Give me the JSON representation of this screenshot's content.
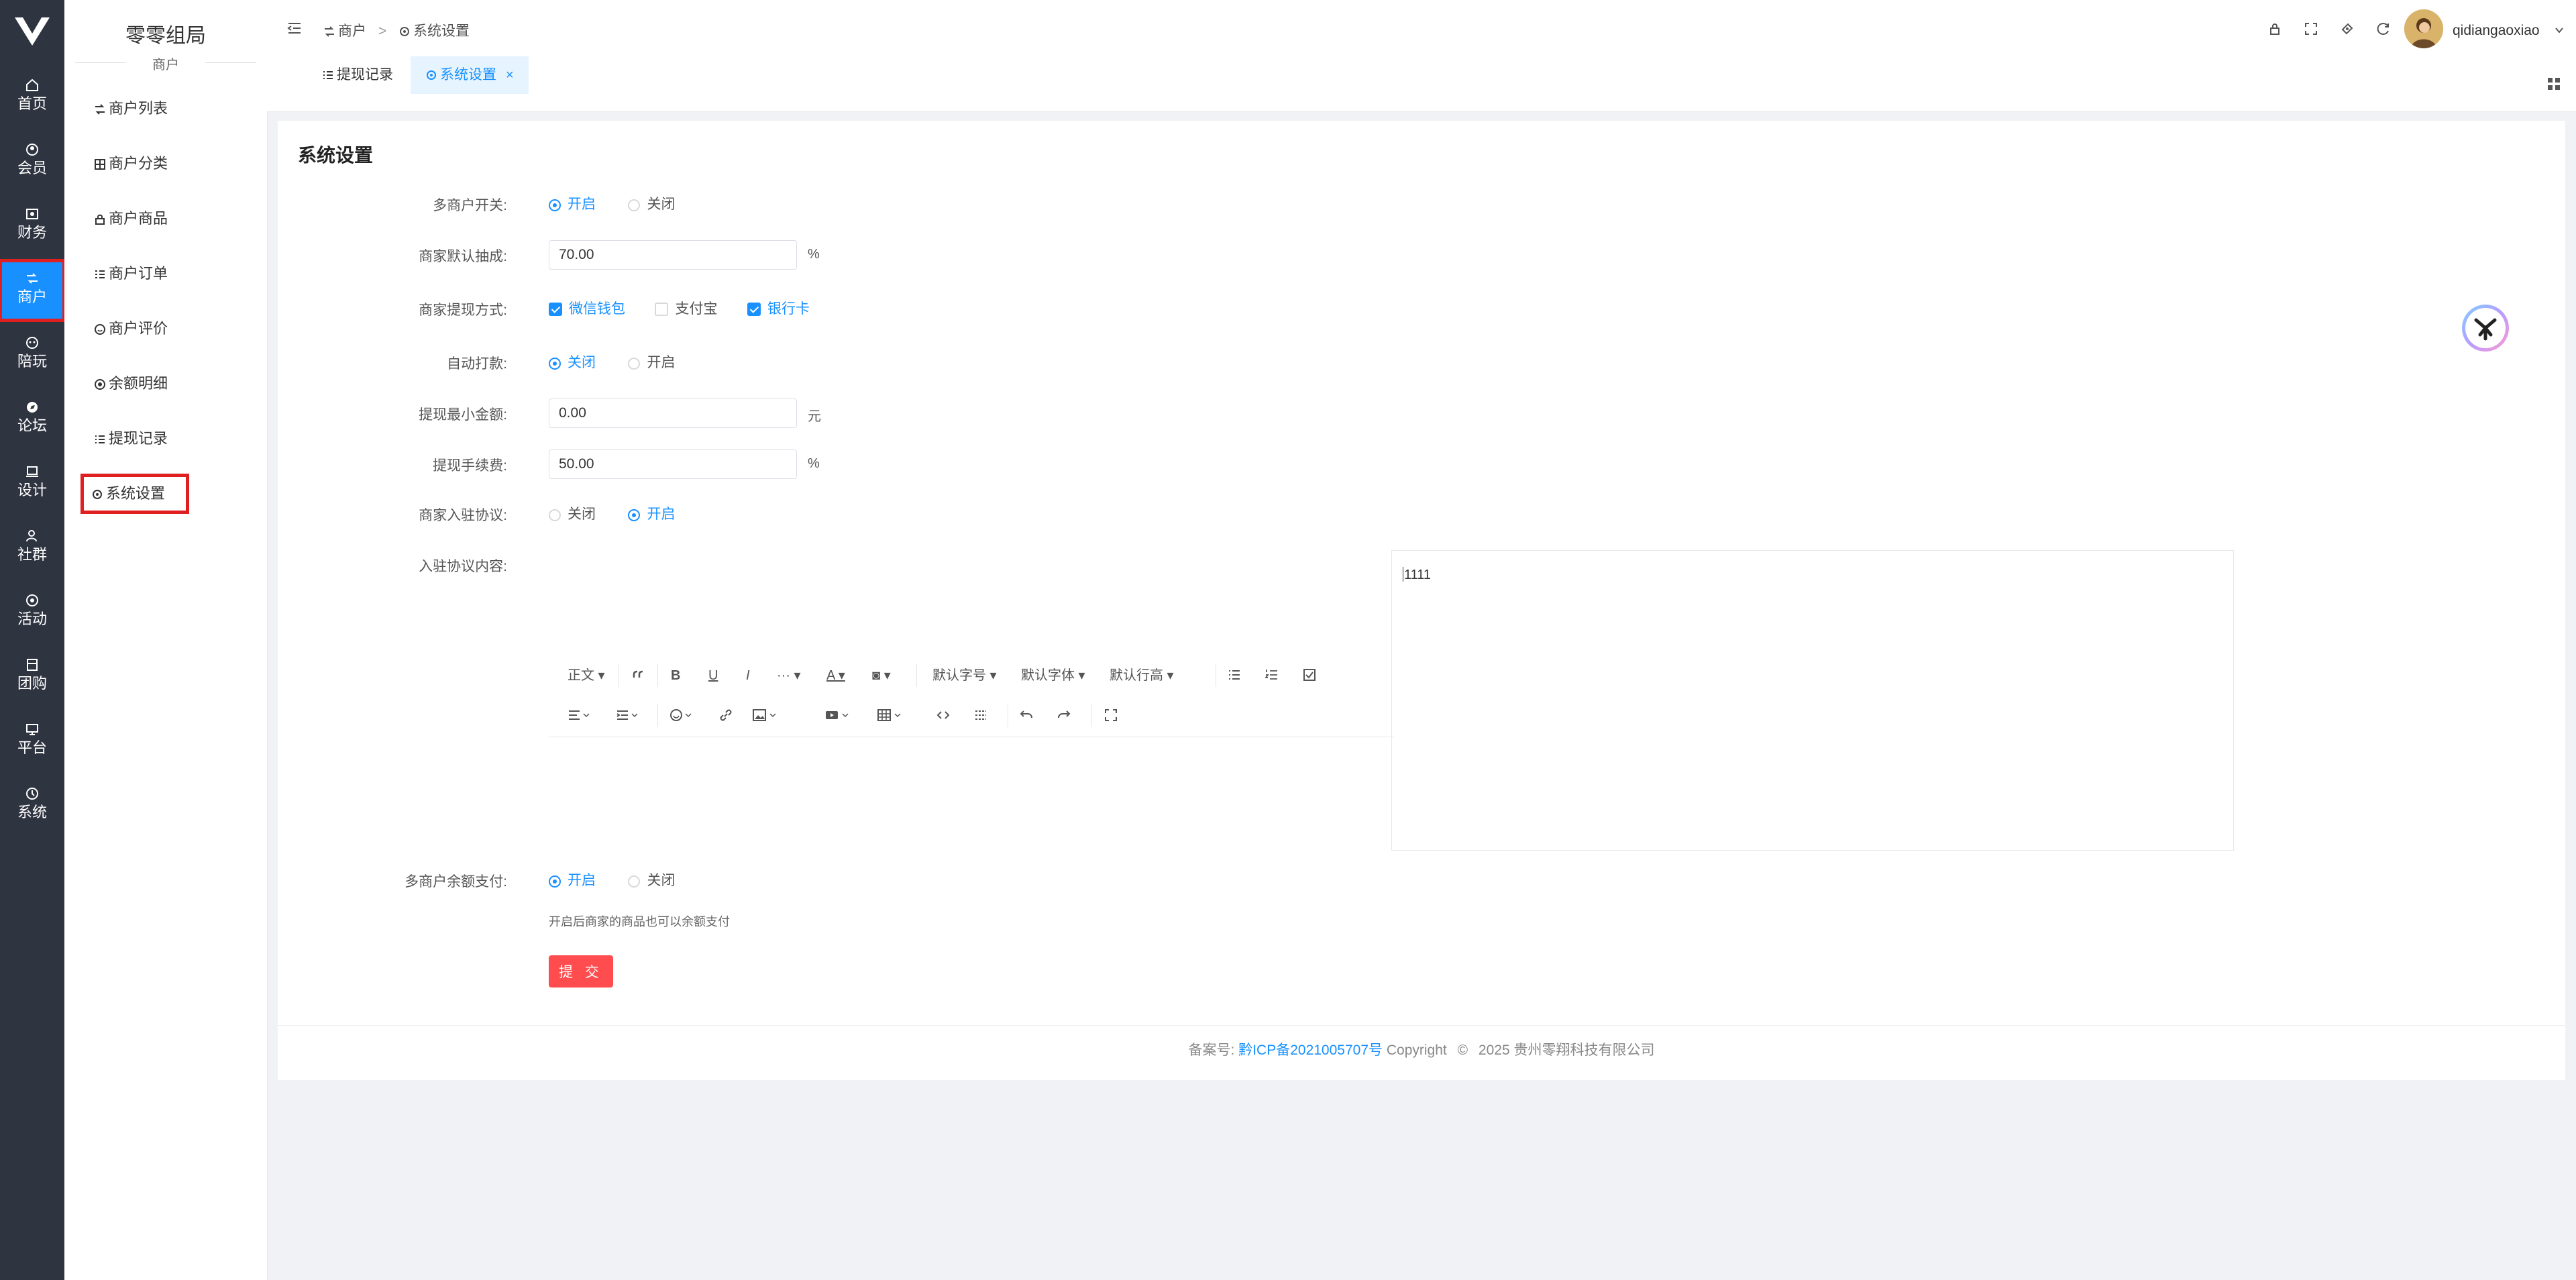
{
  "rail": {
    "items": [
      {
        "label": "首页",
        "icon": "home-icon"
      },
      {
        "label": "会员",
        "icon": "member-icon"
      },
      {
        "label": "财务",
        "icon": "finance-icon"
      },
      {
        "label": "商户",
        "icon": "merchant-icon",
        "active": true
      },
      {
        "label": "陪玩",
        "icon": "companion-icon"
      },
      {
        "label": "论坛",
        "icon": "forum-icon"
      },
      {
        "label": "设计",
        "icon": "design-icon"
      },
      {
        "label": "社群",
        "icon": "community-icon"
      },
      {
        "label": "活动",
        "icon": "activity-icon"
      },
      {
        "label": "团购",
        "icon": "group-buy-icon"
      },
      {
        "label": "平台",
        "icon": "platform-icon"
      },
      {
        "label": "系统",
        "icon": "system-icon"
      }
    ]
  },
  "subnav": {
    "org_name": "零零组局",
    "section": "商户",
    "items": [
      {
        "label": "商户列表",
        "icon": "merchant-list-icon"
      },
      {
        "label": "商户分类",
        "icon": "category-grid-icon"
      },
      {
        "label": "商户商品",
        "icon": "product-lock-icon"
      },
      {
        "label": "商户订单",
        "icon": "order-list-icon"
      },
      {
        "label": "商户评价",
        "icon": "comment-icon"
      },
      {
        "label": "余额明细",
        "icon": "balance-icon"
      },
      {
        "label": "提现记录",
        "icon": "withdraw-list-icon"
      },
      {
        "label": "系统设置",
        "icon": "gear-icon",
        "active": true
      }
    ]
  },
  "header": {
    "breadcrumb": [
      "商户",
      "系统设置"
    ],
    "username": "qidiangaoxiao"
  },
  "tabs": [
    {
      "label": "提现记录",
      "active": false
    },
    {
      "label": "系统设置",
      "active": true,
      "close": "×"
    }
  ],
  "form": {
    "title": "系统设置",
    "multi_merchant": {
      "label": "多商户开关:",
      "options": [
        "开启",
        "关闭"
      ],
      "selected": "开启"
    },
    "default_commission": {
      "label": "商家默认抽成:",
      "value": "70.00",
      "unit": "%"
    },
    "withdraw_methods": {
      "label": "商家提现方式:",
      "options": [
        {
          "label": "微信钱包",
          "checked": true
        },
        {
          "label": "支付宝",
          "checked": false
        },
        {
          "label": "银行卡",
          "checked": true
        }
      ]
    },
    "auto_pay": {
      "label": "自动打款:",
      "options": [
        "关闭",
        "开启"
      ],
      "selected": "关闭"
    },
    "min_withdraw": {
      "label": "提现最小金额:",
      "value": "0.00",
      "unit": "元"
    },
    "withdraw_fee": {
      "label": "提现手续费:",
      "value": "50.00",
      "unit": "%"
    },
    "agreement": {
      "label": "商家入驻协议:",
      "options": [
        "关闭",
        "开启"
      ],
      "selected": "开启"
    },
    "agreement_content": {
      "label": "入驻协议内容:",
      "text": "1111"
    },
    "balance_pay": {
      "label": "多商户余额支付:",
      "options": [
        "开启",
        "关闭"
      ],
      "selected": "开启",
      "hint": "开启后商家的商品也可以余额支付"
    },
    "submit": "提 交"
  },
  "editor": {
    "paragraph": "正文",
    "more": "···",
    "font_size": "默认字号",
    "font_family": "默认字体",
    "line_height": "默认行高"
  },
  "footer": {
    "prefix": "备案号:",
    "icp": "黔ICP备2021005707号",
    "copyright": "Copyright",
    "company": "2025 贵州零翔科技有限公司"
  },
  "colors": {
    "primary": "#1890ff",
    "danger": "#ff4d4f",
    "rail_bg": "#2f3441"
  }
}
